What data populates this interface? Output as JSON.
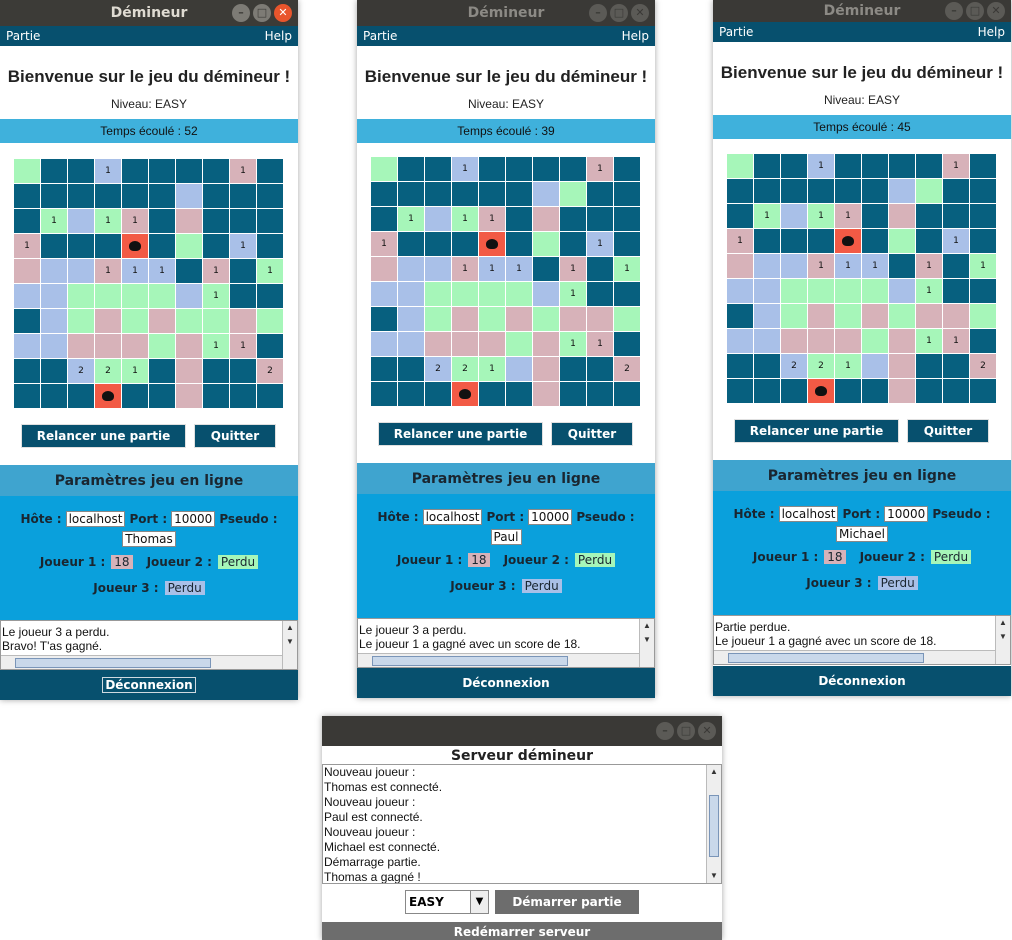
{
  "windows": [
    {
      "title": "Démineur",
      "menu": {
        "left": "Partie",
        "right": "Help"
      },
      "welcome": "Bienvenue sur le jeu du démineur !",
      "level": "Niveau: EASY",
      "timer": "Temps écoulé : 52",
      "grid": [
        [
          "g",
          "d",
          "d",
          "b1",
          "d",
          "d",
          "d",
          "d",
          "p1",
          "d"
        ],
        [
          "d",
          "d",
          "d",
          "d",
          "d",
          "d",
          "b",
          "d",
          "d",
          "d"
        ],
        [
          "d",
          "g1",
          "b",
          "g1",
          "p1",
          "d",
          "p",
          "d",
          "d",
          "d"
        ],
        [
          "p1",
          "d",
          "d",
          "d",
          "m",
          "d",
          "g",
          "d",
          "b1",
          "d"
        ],
        [
          "p",
          "b",
          "b",
          "p1",
          "b1",
          "b1",
          "d",
          "p1",
          "d",
          "g1"
        ],
        [
          "b",
          "b",
          "g",
          "g",
          "g",
          "g",
          "b",
          "g1",
          "d",
          "d"
        ],
        [
          "d",
          "b",
          "g",
          "p",
          "g",
          "p",
          "g",
          "g",
          "p",
          "g"
        ],
        [
          "b",
          "b",
          "p",
          "p",
          "p",
          "g",
          "p",
          "g1",
          "p1",
          "d"
        ],
        [
          "d",
          "d",
          "b2",
          "g2",
          "g1",
          "d",
          "p",
          "d",
          "d",
          "p2"
        ],
        [
          "d",
          "d",
          "d",
          "m",
          "d",
          "d",
          "p",
          "d",
          "d",
          "d"
        ]
      ],
      "restart_label": "Relancer une partie",
      "quit_label": "Quitter",
      "params_title": "Paramètres jeu en ligne",
      "host_label": "Hôte :",
      "host_value": "localhost",
      "port_label": "Port :",
      "port_value": "10000",
      "pseudo_label": "Pseudo :",
      "pseudo_value": "Thomas",
      "p1_label": "Joueur 1 :",
      "p1_value": "18",
      "p2_label": "Joueur 2 :",
      "p2_value": "Perdu",
      "p3_label": "Joueur 3 :",
      "p3_value": "Perdu",
      "log": [
        "Le joueur 3 a perdu.",
        "Bravo! T'as gagné."
      ],
      "disconnect_label": "Déconnexion"
    },
    {
      "title": "Démineur",
      "menu": {
        "left": "Partie",
        "right": "Help"
      },
      "welcome": "Bienvenue sur le jeu du démineur !",
      "level": "Niveau: EASY",
      "timer": "Temps écoulé : 39",
      "grid": [
        [
          "g",
          "d",
          "d",
          "b1",
          "d",
          "d",
          "d",
          "d",
          "p1",
          "d"
        ],
        [
          "d",
          "d",
          "d",
          "d",
          "d",
          "d",
          "b",
          "g",
          "d",
          "d"
        ],
        [
          "d",
          "g1",
          "b",
          "g1",
          "p1",
          "d",
          "p",
          "d",
          "d",
          "d"
        ],
        [
          "p1",
          "d",
          "d",
          "d",
          "m",
          "d",
          "g",
          "d",
          "b1",
          "d"
        ],
        [
          "p",
          "b",
          "b",
          "p1",
          "b1",
          "b1",
          "d",
          "p1",
          "d",
          "g1"
        ],
        [
          "b",
          "b",
          "g",
          "g",
          "g",
          "g",
          "b",
          "g1",
          "d",
          "d"
        ],
        [
          "d",
          "b",
          "g",
          "p",
          "g",
          "p",
          "g",
          "p",
          "p",
          "g"
        ],
        [
          "b",
          "b",
          "p",
          "p",
          "p",
          "g",
          "p",
          "g1",
          "p1",
          "d"
        ],
        [
          "d",
          "d",
          "b2",
          "g2",
          "g1",
          "b",
          "p",
          "d",
          "d",
          "p2"
        ],
        [
          "d",
          "d",
          "d",
          "m",
          "d",
          "d",
          "p",
          "d",
          "d",
          "d"
        ]
      ],
      "restart_label": "Relancer une partie",
      "quit_label": "Quitter",
      "params_title": "Paramètres jeu en ligne",
      "host_label": "Hôte :",
      "host_value": "localhost",
      "port_label": "Port :",
      "port_value": "10000",
      "pseudo_label": "Pseudo :",
      "pseudo_value": "Paul",
      "p1_label": "Joueur 1 :",
      "p1_value": "18",
      "p2_label": "Joueur 2 :",
      "p2_value": "Perdu",
      "p3_label": "Joueur 3 :",
      "p3_value": "Perdu",
      "log": [
        "Le joueur 3 a perdu.",
        "Le joueur 1 a gagné avec un score de 18."
      ],
      "disconnect_label": "Déconnexion"
    },
    {
      "title": "Démineur",
      "menu": {
        "left": "Partie",
        "right": "Help"
      },
      "welcome": "Bienvenue sur le jeu du démineur !",
      "level": "Niveau: EASY",
      "timer": "Temps écoulé : 45",
      "grid": [
        [
          "g",
          "d",
          "d",
          "b1",
          "d",
          "d",
          "d",
          "d",
          "p1",
          "d"
        ],
        [
          "d",
          "d",
          "d",
          "d",
          "d",
          "d",
          "b",
          "g",
          "d",
          "d"
        ],
        [
          "d",
          "g1",
          "b",
          "g1",
          "p1",
          "d",
          "p",
          "d",
          "d",
          "d"
        ],
        [
          "p1",
          "d",
          "d",
          "d",
          "m",
          "d",
          "g",
          "d",
          "b1",
          "d"
        ],
        [
          "p",
          "b",
          "b",
          "p1",
          "b1",
          "b1",
          "d",
          "p1",
          "d",
          "g1"
        ],
        [
          "b",
          "b",
          "g",
          "g",
          "g",
          "g",
          "b",
          "g1",
          "d",
          "d"
        ],
        [
          "d",
          "b",
          "g",
          "p",
          "g",
          "p",
          "g",
          "p",
          "p",
          "g"
        ],
        [
          "b",
          "b",
          "p",
          "p",
          "p",
          "g",
          "p",
          "g1",
          "p1",
          "d"
        ],
        [
          "d",
          "d",
          "b2",
          "g2",
          "g1",
          "b",
          "p",
          "d",
          "d",
          "p2"
        ],
        [
          "d",
          "d",
          "d",
          "m",
          "d",
          "d",
          "p",
          "d",
          "d",
          "d"
        ]
      ],
      "restart_label": "Relancer une partie",
      "quit_label": "Quitter",
      "params_title": "Paramètres jeu en ligne",
      "host_label": "Hôte :",
      "host_value": "localhost",
      "port_label": "Port :",
      "port_value": "10000",
      "pseudo_label": "Pseudo :",
      "pseudo_value": "Michael",
      "p1_label": "Joueur 1 :",
      "p1_value": "18",
      "p2_label": "Joueur 2 :",
      "p2_value": "Perdu",
      "p3_label": "Joueur 3 :",
      "p3_value": "Perdu",
      "log": [
        "Partie perdue.",
        "Le joueur 1 a gagné avec un score de 18."
      ],
      "disconnect_label": "Déconnexion"
    }
  ],
  "server": {
    "title": "Serveur démineur",
    "log": [
      "Nouveau joueur :",
      "Thomas est connecté.",
      "Nouveau joueur :",
      "Paul est connecté.",
      "Nouveau joueur :",
      "Michael est connecté.",
      "Démarrage partie.",
      "Thomas a gagné !"
    ],
    "level_selected": "EASY",
    "start_label": "Démarrer partie",
    "restart_label": "Redémarrer serveur"
  },
  "colors": {
    "unrevealed": "#07607f",
    "player1": "#d7b2b9",
    "player2": "#a6f6b9",
    "player3": "#a9c0e8",
    "mine": "#f25a45"
  }
}
